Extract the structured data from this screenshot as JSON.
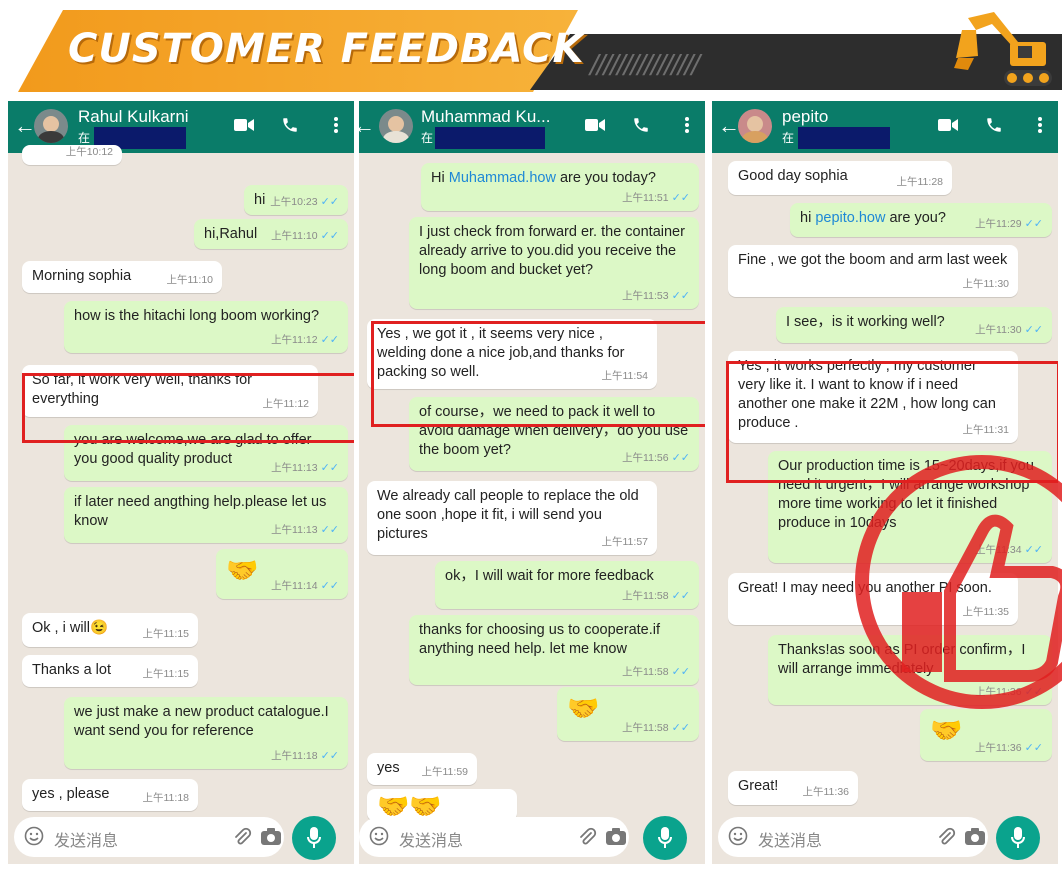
{
  "banner": {
    "title": "CUSTOMER FEEDBACK",
    "slashes": "////////////////"
  },
  "input_placeholder": "发送消息",
  "colors": {
    "header": "#0a7c69",
    "incoming": "#ffffff",
    "outgoing": "#dcf8c6",
    "highlight": "#e02020",
    "mic": "#0aa38d"
  },
  "panels": [
    {
      "contact": "Rahul Kulkarni",
      "status": "在",
      "messages": [
        {
          "dir": "in",
          "time": "上午10:12",
          "text": ""
        },
        {
          "dir": "out",
          "time": "上午10:23",
          "text": "hi"
        },
        {
          "dir": "out",
          "time": "上午11:10",
          "text": "hi,Rahul"
        },
        {
          "dir": "in",
          "time": "上午11:10",
          "text": "Morning sophia"
        },
        {
          "dir": "out",
          "time": "上午11:12",
          "text": "how is the hitachi long boom working?"
        },
        {
          "dir": "in",
          "time": "上午11:12",
          "text": "So far, it work very well, thanks for everything"
        },
        {
          "dir": "out",
          "time": "上午11:13",
          "text": "you are welcome,we are glad to offer you good quality product"
        },
        {
          "dir": "out",
          "time": "上午11:13",
          "text": "if later need angthing help.please let us know"
        },
        {
          "dir": "out",
          "time": "上午11:14",
          "text": "🤝"
        },
        {
          "dir": "in",
          "time": "上午11:15",
          "text": "Ok , i will😉"
        },
        {
          "dir": "in",
          "time": "上午11:15",
          "text": "Thanks a lot"
        },
        {
          "dir": "out",
          "time": "上午11:18",
          "text": "we just make a new product catalogue.I want send you for reference"
        },
        {
          "dir": "in",
          "time": "上午11:18",
          "text": "yes , please"
        }
      ]
    },
    {
      "contact": "Muhammad Ku...",
      "status": "在",
      "messages": [
        {
          "dir": "out",
          "time": "上午11:51",
          "text_pre": "Hi ",
          "link": "Muhammad.how",
          "text_post": " are you today?"
        },
        {
          "dir": "out",
          "time": "上午11:53",
          "text": "I just check from forward er. the container already arrive to you.did you receive the long boom and bucket yet?"
        },
        {
          "dir": "in",
          "time": "上午11:54",
          "text": "Yes , we got it , it seems very nice , welding done a nice job,and thanks for packing so well."
        },
        {
          "dir": "out",
          "time": "上午11:56",
          "text": "of course，we need to pack it well to avoid damage when delivery，do you use the boom yet?"
        },
        {
          "dir": "in",
          "time": "上午11:57",
          "text": "We already call people to replace the old one soon ,hope it fit, i will send you pictures"
        },
        {
          "dir": "out",
          "time": "上午11:58",
          "text": "ok，I will wait for more feedback"
        },
        {
          "dir": "out",
          "time": "上午11:58",
          "text": "thanks for choosing us to cooperate.if anything need help. let me know"
        },
        {
          "dir": "out",
          "time": "上午11:58",
          "text": "🤝"
        },
        {
          "dir": "in",
          "time": "上午11:59",
          "text": "yes"
        },
        {
          "dir": "in",
          "time": "",
          "text": "🤝🤝"
        }
      ]
    },
    {
      "contact": "pepito",
      "status": "在",
      "messages": [
        {
          "dir": "in",
          "time": "上午11:28",
          "text": "Good day sophia"
        },
        {
          "dir": "out",
          "time": "上午11:29",
          "text_pre": "hi ",
          "link": "pepito.how",
          "text_post": " are you?"
        },
        {
          "dir": "in",
          "time": "上午11:30",
          "text": "Fine , we got the boom and arm last week"
        },
        {
          "dir": "out",
          "time": "上午11:30",
          "text": "I see，is it working well?"
        },
        {
          "dir": "in",
          "time": "上午11:31",
          "text": "Yes , it works perfectly , my customer very like it. I want to know if i need another one make it 22M , how long can produce ."
        },
        {
          "dir": "out",
          "time": "上午11:34",
          "text": "Our production time is 15~20days,if you need it urgent，I will arrange workshop more time working to let it finished produce in 10days"
        },
        {
          "dir": "in",
          "time": "上午11:35",
          "text": "Great! I may need you another PI soon."
        },
        {
          "dir": "out",
          "time": "上午11:36",
          "text": "Thanks!as soon as PI order confirm，I will arrange immediately"
        },
        {
          "dir": "out",
          "time": "上午11:36",
          "text": "🤝"
        },
        {
          "dir": "in",
          "time": "上午11:36",
          "text": "Great!"
        }
      ]
    }
  ]
}
